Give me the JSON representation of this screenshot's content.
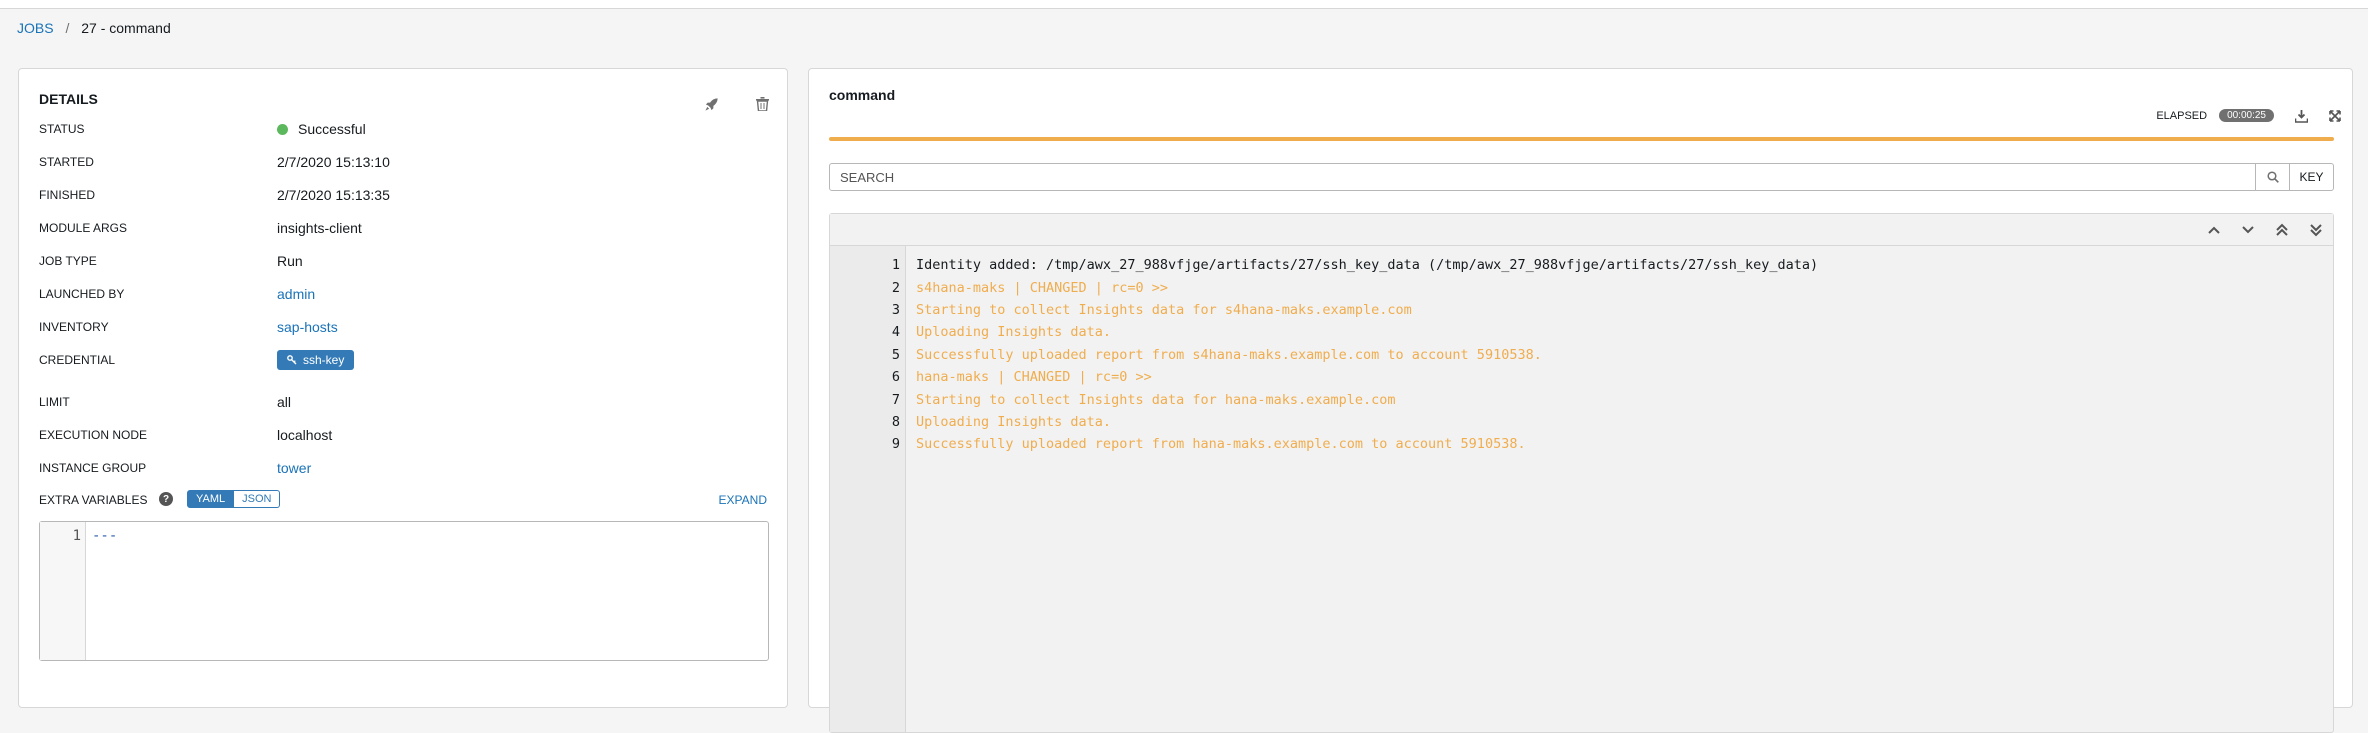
{
  "breadcrumb": {
    "root": "JOBS",
    "separator": "/",
    "current": "27 - command"
  },
  "details": {
    "title": "DETAILS",
    "relaunch_icon": "rocket-icon",
    "delete_icon": "trash-icon",
    "rows": {
      "status": {
        "label": "STATUS",
        "value": "Successful"
      },
      "started": {
        "label": "STARTED",
        "value": "2/7/2020 15:13:10"
      },
      "finished": {
        "label": "FINISHED",
        "value": "2/7/2020 15:13:35"
      },
      "module_args": {
        "label": "MODULE ARGS",
        "value": "insights-client"
      },
      "job_type": {
        "label": "JOB TYPE",
        "value": "Run"
      },
      "launched_by": {
        "label": "LAUNCHED BY",
        "value": "admin"
      },
      "inventory": {
        "label": "INVENTORY",
        "value": "sap-hosts"
      },
      "credential": {
        "label": "CREDENTIAL",
        "value": "ssh-key"
      },
      "limit": {
        "label": "LIMIT",
        "value": "all"
      },
      "execution_node": {
        "label": "EXECUTION NODE",
        "value": "localhost"
      },
      "instance_group": {
        "label": "INSTANCE GROUP",
        "value": "tower"
      }
    },
    "extra_vars": {
      "label": "EXTRA VARIABLES",
      "help": "?",
      "yaml": "YAML",
      "json": "JSON",
      "expand": "EXPAND",
      "line_number": "1",
      "content": "---"
    }
  },
  "output": {
    "title": "command",
    "elapsed_label": "ELAPSED",
    "elapsed_value": "00:00:25",
    "progress_fraction": 1.0,
    "search_placeholder": "SEARCH",
    "key_label": "KEY",
    "lines": [
      {
        "n": "1",
        "text": "Identity added: /tmp/awx_27_988vfjge/artifacts/27/ssh_key_data (/tmp/awx_27_988vfjge/artifacts/27/ssh_key_data)",
        "style": "plain"
      },
      {
        "n": "2",
        "text": "s4hana-maks | CHANGED | rc=0 >>",
        "style": "changed"
      },
      {
        "n": "3",
        "text": "Starting to collect Insights data for s4hana-maks.example.com",
        "style": "changed"
      },
      {
        "n": "4",
        "text": "Uploading Insights data.",
        "style": "changed"
      },
      {
        "n": "5",
        "text": "Successfully uploaded report from s4hana-maks.example.com to account 5910538.",
        "style": "changed"
      },
      {
        "n": "6",
        "text": "hana-maks | CHANGED | rc=0 >>",
        "style": "changed"
      },
      {
        "n": "7",
        "text": "Starting to collect Insights data for hana-maks.example.com",
        "style": "changed"
      },
      {
        "n": "8",
        "text": "Uploading Insights data.",
        "style": "changed"
      },
      {
        "n": "9",
        "text": "Successfully uploaded report from hana-maks.example.com to account 5910538.",
        "style": "changed"
      }
    ],
    "colors": {
      "changed": "#f0ad4e",
      "success": "#5cb85c",
      "link": "#1a73b8"
    }
  }
}
